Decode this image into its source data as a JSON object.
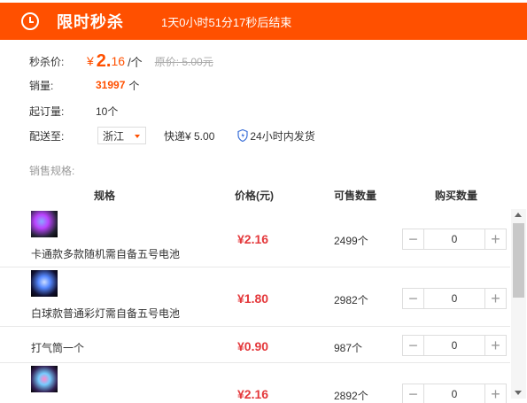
{
  "banner": {
    "title": "限时秒杀",
    "countdown": "1天0小时51分17秒后结束",
    "icon": "alarm-clock-icon",
    "color": "#ff5000"
  },
  "info": {
    "price_label": "秒杀价:",
    "price_symbol": "¥",
    "price_int": "2.",
    "price_dec": "16",
    "price_unit": "/个",
    "orig_price": "原价: 5.00元",
    "sales_label": "销量:",
    "sales_value": "31997",
    "sales_unit": "个",
    "moq_label": "起订量:",
    "moq_value": "10个",
    "ship_label": "配送至:",
    "ship_region": "浙江",
    "shipping": "快递¥ 5.00",
    "promise": "24小时内发货"
  },
  "spec_section_label": "销售规格:",
  "table": {
    "headers": [
      "规格",
      "价格(元)",
      "可售数量",
      "购买数量"
    ],
    "rows": [
      {
        "name": "卡通款多款随机需自备五号电池",
        "price": "¥2.16",
        "stock": "2499个",
        "qty": "0",
        "has_thumb": true
      },
      {
        "name": "白球款普通彩灯需自备五号电池",
        "price": "¥1.80",
        "stock": "2982个",
        "qty": "0",
        "has_thumb": true
      },
      {
        "name": "打气筒一个",
        "price": "¥0.90",
        "stock": "987个",
        "qty": "0",
        "has_thumb": false
      },
      {
        "name": "",
        "price": "¥2.16",
        "stock": "2892个",
        "qty": "0",
        "has_thumb": true
      }
    ]
  },
  "colors": {
    "accent": "#ff5000",
    "price_red": "#e4393c"
  }
}
